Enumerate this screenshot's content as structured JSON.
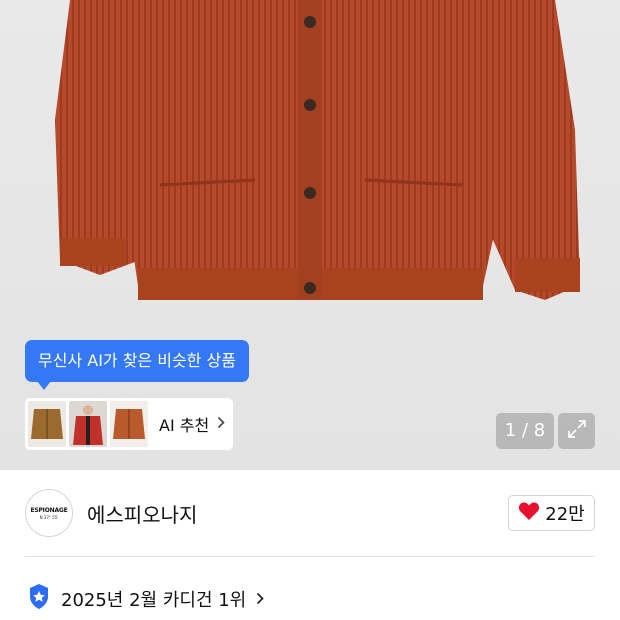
{
  "gallery": {
    "tooltip": "무신사 AI가 찾은 비슷한 상품",
    "ai_recommend_label": "AI 추천",
    "counter": "1 / 8",
    "sweater_color": "#b5492a"
  },
  "brand": {
    "logo_line1": "ESPIONAGE",
    "logo_line2": "N 37° 55'",
    "name": "에스피오나지"
  },
  "like": {
    "count": "22만",
    "heart_color": "#e8102f"
  },
  "ranking": {
    "text": "2025년 2월 카디건 1위",
    "badge_color": "#2d6cf6"
  }
}
